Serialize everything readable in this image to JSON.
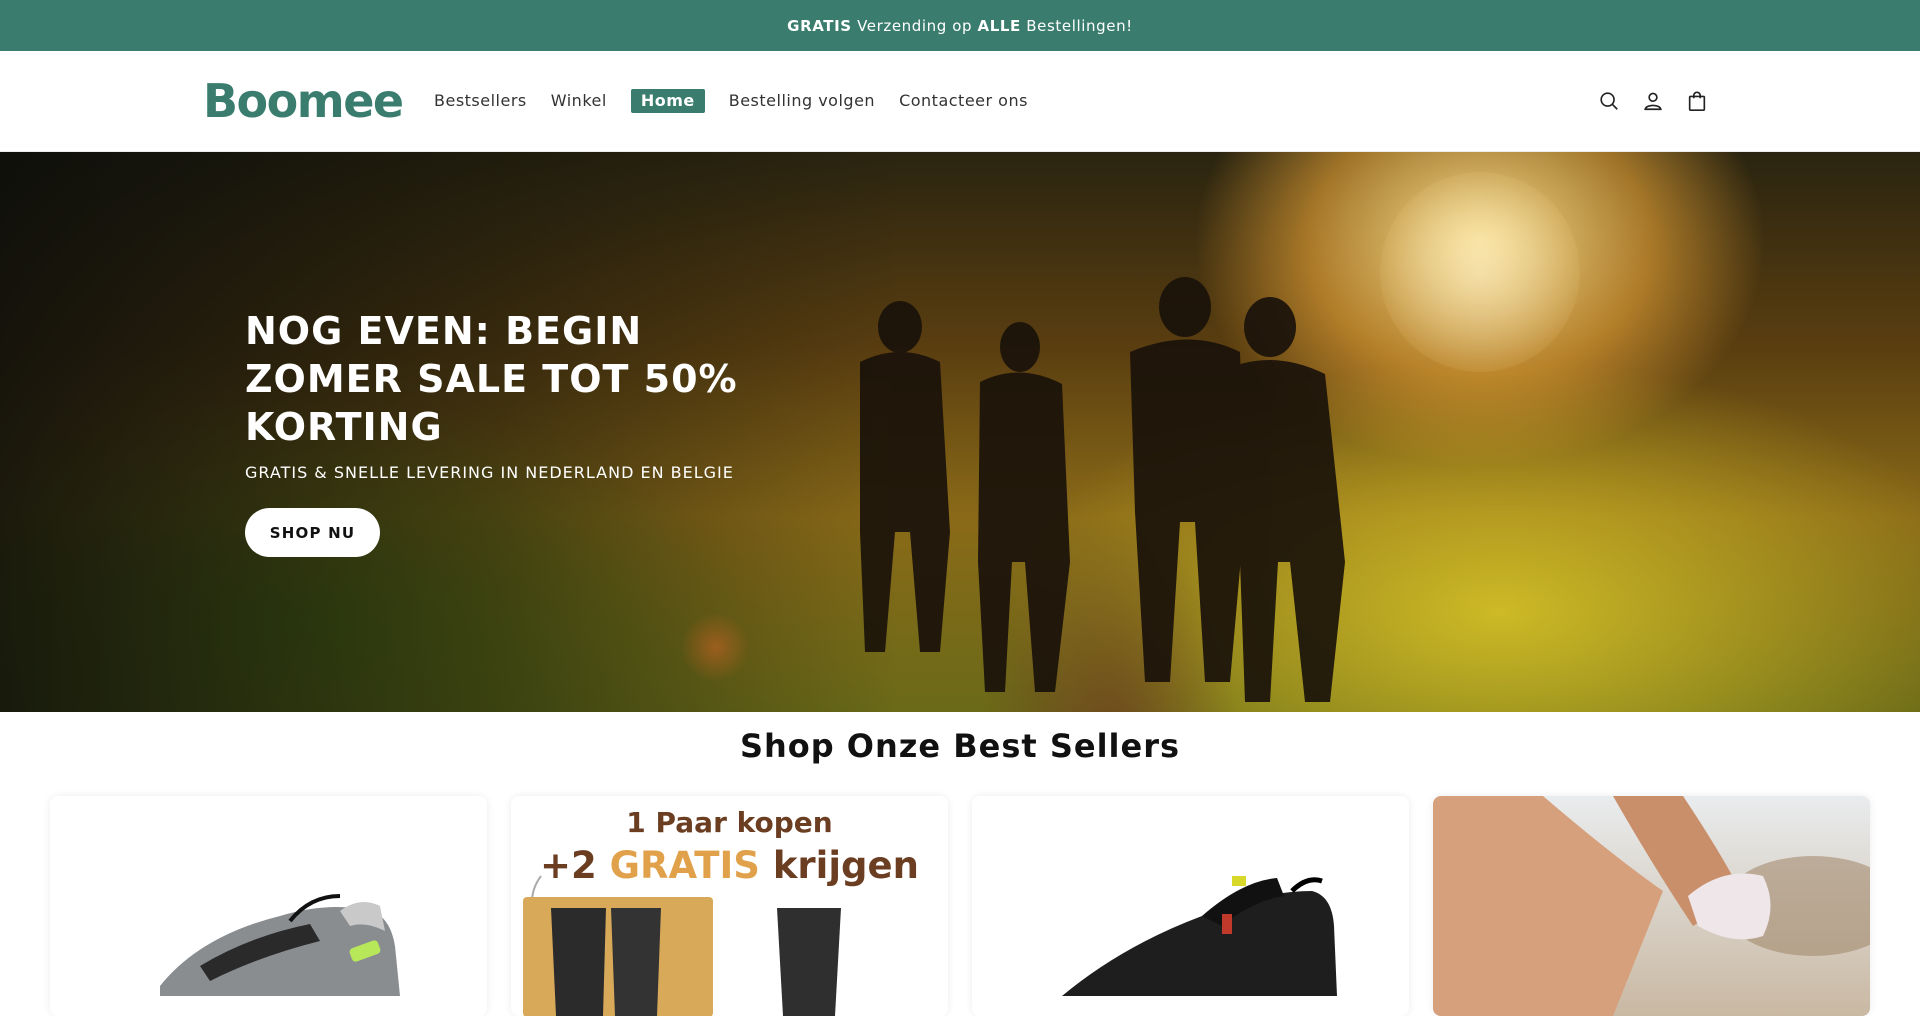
{
  "announcement": {
    "part1": "GRATIS",
    "part2": " Verzending op ",
    "part3": "ALLE",
    "part4": " Bestellingen!"
  },
  "brand": {
    "name": "Boomee",
    "color": "#3a7d6e"
  },
  "nav": {
    "items": [
      {
        "label": "Bestsellers"
      },
      {
        "label": "Winkel"
      },
      {
        "label": "Home",
        "active": true
      },
      {
        "label": "Bestelling volgen"
      },
      {
        "label": "Contacteer ons"
      }
    ]
  },
  "header_icons": [
    "search-icon",
    "account-icon",
    "cart-icon"
  ],
  "hero": {
    "title": "NOG EVEN: BEGIN ZOMER SALE TOT 50% KORTING",
    "subtitle": "GRATIS & SNELLE LEVERING IN NEDERLAND EN BELGIE",
    "button_label": "SHOP NU"
  },
  "bestsellers": {
    "title": "Shop Onze Best Sellers",
    "promo_card": {
      "line1": "1 Paar kopen",
      "line2_prefix": "+2 ",
      "line2_highlight": "GRATIS",
      "line2_suffix": " krijgen"
    }
  }
}
